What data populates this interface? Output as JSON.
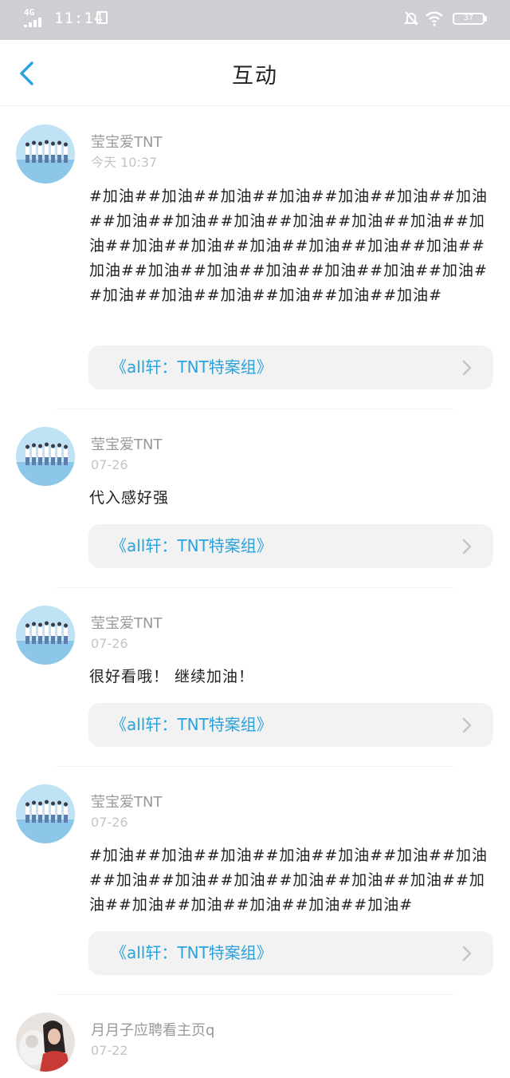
{
  "status_bar": {
    "network": "4G",
    "time": "11:14",
    "battery": "37"
  },
  "header": {
    "back_icon": "chevron-left-icon",
    "title": "互动"
  },
  "colors": {
    "accent": "#2aa3dd",
    "link_bg": "#f2f2f2",
    "status_bar_bg": "#cfcfd3",
    "username": "#9a9a9a",
    "timestamp": "#c4c4c4",
    "body_text": "#222222"
  },
  "comments": [
    {
      "username": "莹宝爱TNT",
      "time": "今天 10:37",
      "text": "#加油##加油##加油##加油##加油##加油##加油##加油##加油##加油##加油##加油##加油##加油##加油##加油##加油##加油##加油##加油##加油##加油##加油##加油##加油##加油##加油##加油##加油##加油##加油##加油##加油#",
      "link": "《all轩：TNT特案组》"
    },
    {
      "username": "莹宝爱TNT",
      "time": "07-26",
      "text": "代入感好强",
      "link": "《all轩：TNT特案组》"
    },
    {
      "username": "莹宝爱TNT",
      "time": "07-26",
      "text": "很好看哦！ 继续加油！",
      "link": "《all轩：TNT特案组》"
    },
    {
      "username": "莹宝爱TNT",
      "time": "07-26",
      "text": "#加油##加油##加油##加油##加油##加油##加油##加油##加油##加油##加油##加油##加油##加油##加油##加油##加油##加油##加油#",
      "link": "《all轩：TNT特案组》"
    },
    {
      "username": "月月子应聘看主页q",
      "time": "07-22"
    }
  ]
}
